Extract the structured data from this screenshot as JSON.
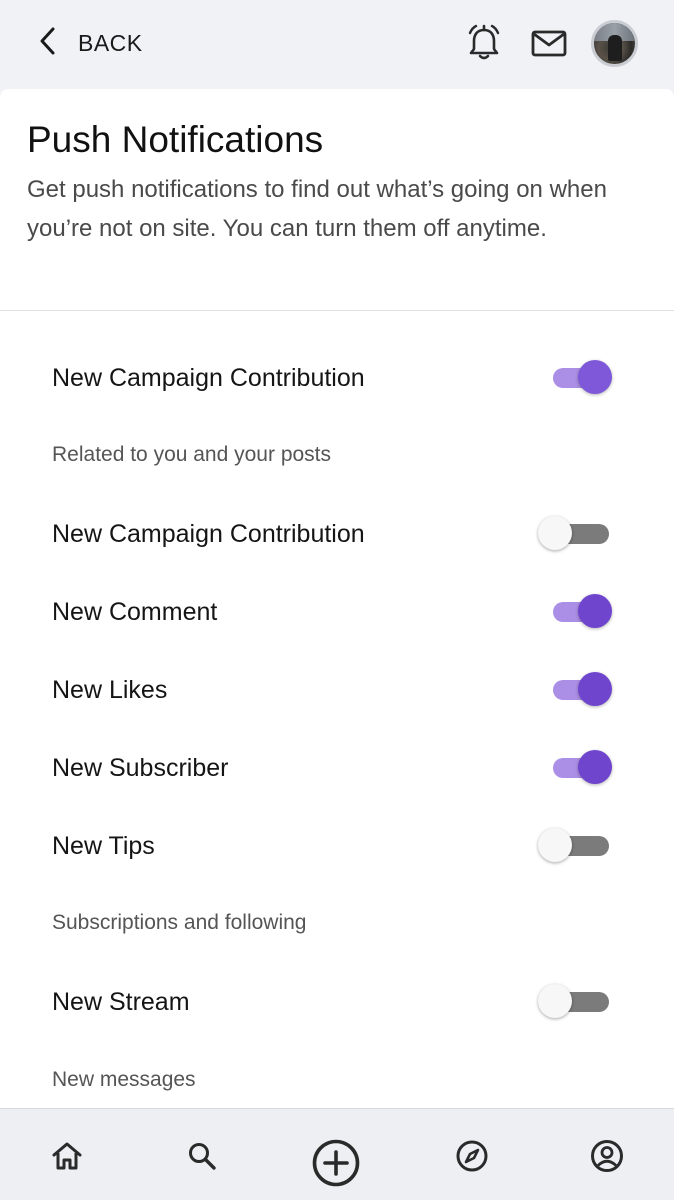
{
  "header": {
    "back_label": "BACK",
    "icons": [
      "chevron-left-icon",
      "alarm-bell-icon",
      "mail-icon",
      "avatar"
    ]
  },
  "page": {
    "title": "Push Notifications",
    "description": "Get push notifications to find out what’s going on when you’re not on site. You can turn them off anytime."
  },
  "settings": {
    "top": {
      "label": "New Campaign Contribution",
      "on": true
    },
    "section1": "Related to you and your posts",
    "section1_items": [
      {
        "label": "New Campaign Contribution",
        "on": false
      },
      {
        "label": "New Comment",
        "on": true
      },
      {
        "label": "New Likes",
        "on": true
      },
      {
        "label": "New Subscriber",
        "on": true
      },
      {
        "label": "New Tips",
        "on": false
      }
    ],
    "section2": "Subscriptions and following",
    "section2_items": [
      {
        "label": "New Stream",
        "on": false
      }
    ],
    "section3": "New messages"
  },
  "bottom_nav": [
    "home-icon",
    "search-icon",
    "add-circle-icon",
    "compass-icon",
    "profile-icon"
  ],
  "colors": {
    "accent": "#6f45cd",
    "accent_track": "#ab8ee5",
    "off_track": "#7b7b7b",
    "background": "#f1f2f6"
  }
}
